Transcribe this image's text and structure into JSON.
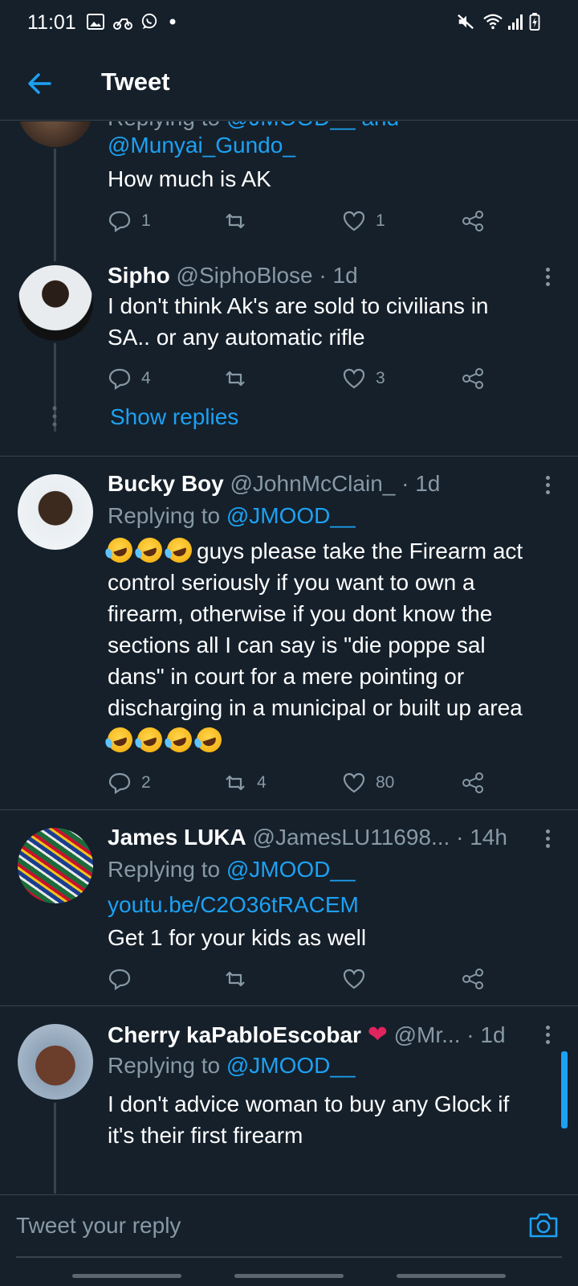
{
  "status_bar": {
    "time": "11:01",
    "left_icons": [
      "gallery-icon",
      "scooter-icon",
      "whatsapp-icon",
      "dot-icon"
    ],
    "right_icons": [
      "mute-icon",
      "wifi-icon",
      "signal-icon",
      "battery-icon"
    ]
  },
  "header": {
    "title": "Tweet",
    "back_icon": "arrow-left-icon"
  },
  "tweets": [
    {
      "reply_prefix": "Replying to",
      "mentions": [
        "@JMOOD__",
        "and",
        "@Munyai_Gundo_"
      ],
      "text": "How much is AK",
      "actions": {
        "replies": "1",
        "retweets": "",
        "likes": "1"
      }
    },
    {
      "name": "Sipho",
      "handle": "@SiphoBlose",
      "time": "· 1d",
      "text_lines": [
        "I don't think Ak's are sold to civilians in",
        "SA.. or any automatic rifle"
      ],
      "actions": {
        "replies": "4",
        "retweets": "",
        "likes": "3"
      },
      "show_replies": "Show replies"
    },
    {
      "name": "Bucky Boy",
      "handle": "@JohnMcClain_",
      "time": "· 1d",
      "reply_prefix": "Replying to",
      "reply_to": "@JMOOD__",
      "text_lines": [
        "guys please take the Firearm act",
        "control seriously if you want to own a",
        "firearm, otherwise if you dont know the",
        "sections all I can say is \"die poppe sal",
        "dans\" in court for a mere pointing or",
        "discharging in a municipal or built up area"
      ],
      "leading_emoji": [
        "rolling-on-floor-laughing-emoji",
        "rolling-on-floor-laughing-emoji",
        "rolling-on-floor-laughing-emoji"
      ],
      "trailing_emoji": [
        "rolling-on-floor-laughing-emoji",
        "rolling-on-floor-laughing-emoji",
        "rolling-on-floor-laughing-emoji",
        "rolling-on-floor-laughing-emoji"
      ],
      "actions": {
        "replies": "2",
        "retweets": "4",
        "likes": "80"
      }
    },
    {
      "name": "James LUKA",
      "handle": "@JamesLU11698...",
      "time": "· 14h",
      "reply_prefix": "Replying to",
      "reply_to": "@JMOOD__",
      "link": "youtu.be/C2O36tRACEM",
      "text": "Get 1 for your kids as well",
      "actions": {
        "replies": "",
        "retweets": "",
        "likes": ""
      }
    },
    {
      "name": "Cherry kaPabloEscobar",
      "name_badge": "heart-emoji",
      "handle": "@Mr...",
      "time": "· 1d",
      "reply_prefix": "Replying to",
      "reply_to": "@JMOOD__",
      "text_lines": [
        "I don't advice woman to buy any Glock if",
        "it's their first firearm"
      ]
    }
  ],
  "composer": {
    "placeholder": "Tweet your reply",
    "camera_icon": "camera-icon"
  },
  "colors": {
    "background": "#15202b",
    "accent": "#1da1f2",
    "secondary_text": "#8899a6",
    "divider": "#38444d",
    "heart": "#e0245e"
  }
}
